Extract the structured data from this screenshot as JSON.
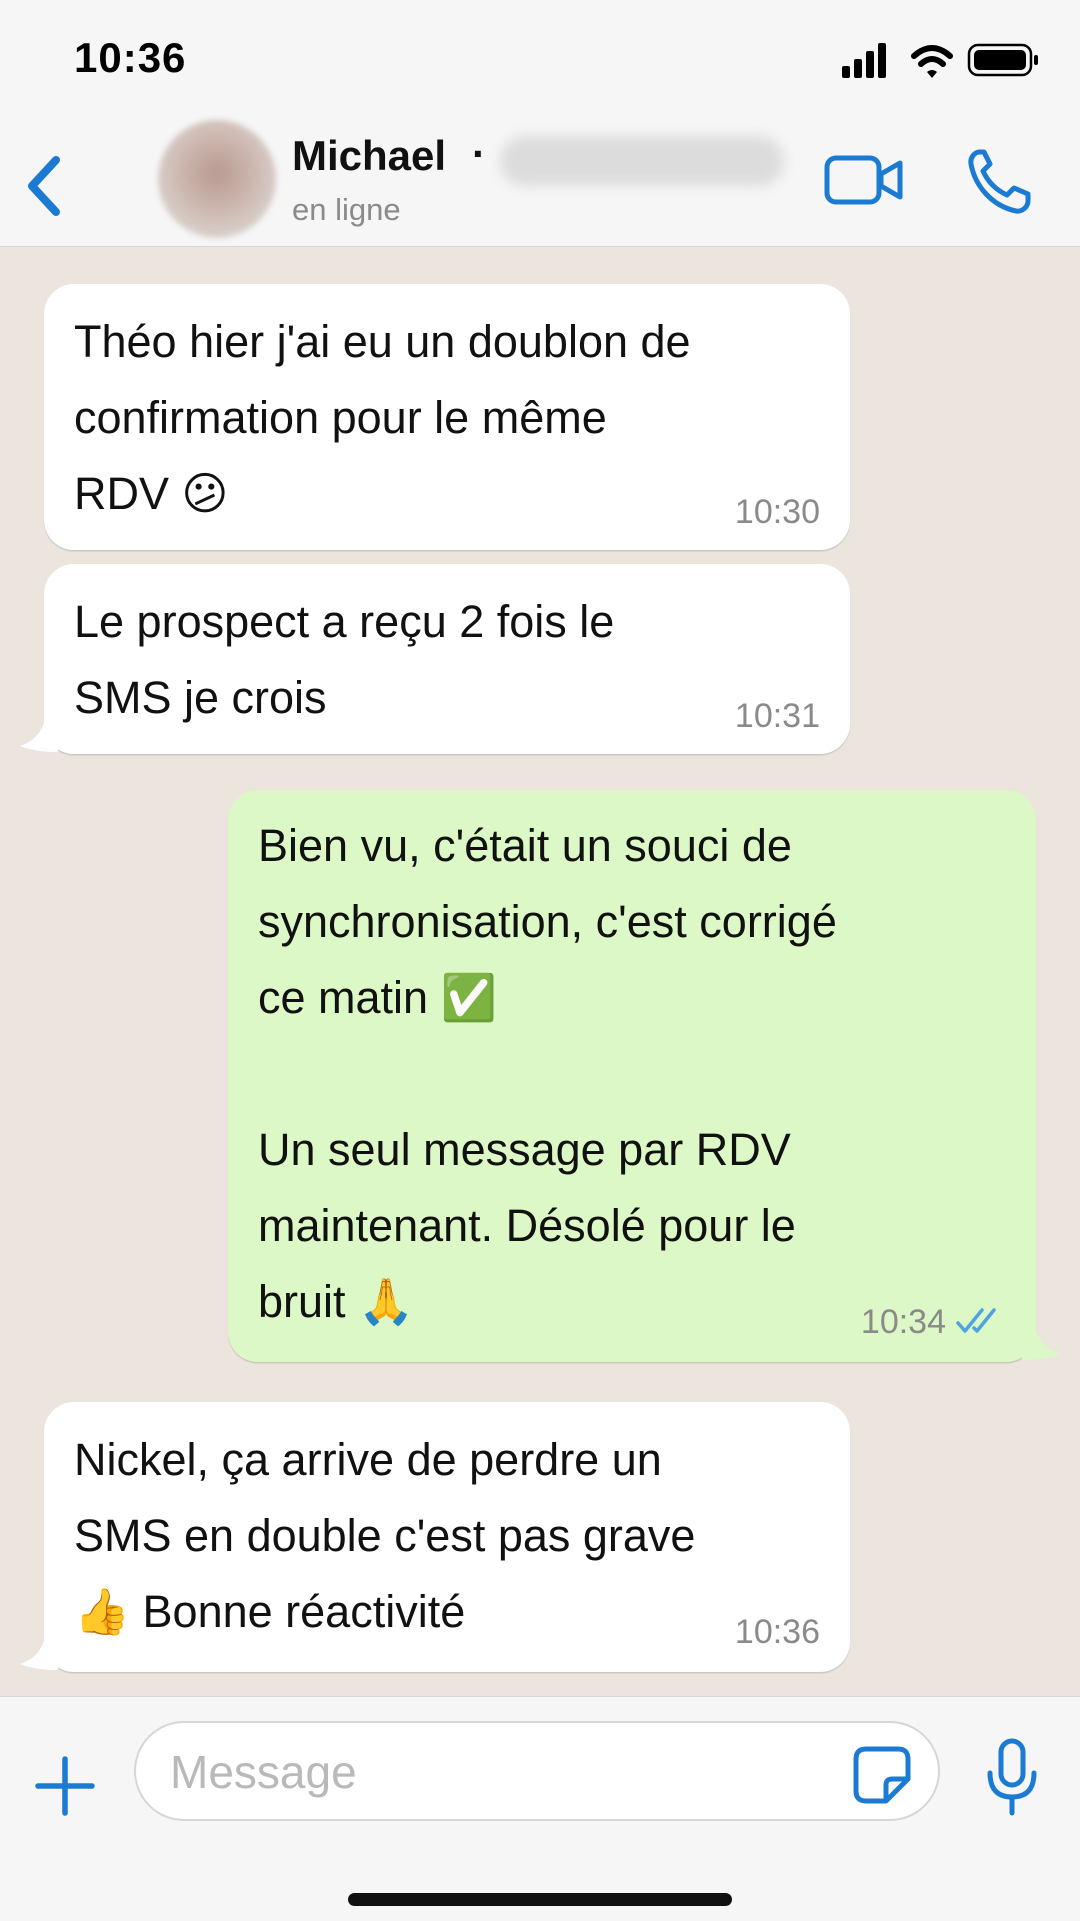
{
  "status_bar": {
    "time": "10:36"
  },
  "header": {
    "contact_name": "Michael",
    "separator": "·",
    "contact_status": "en ligne",
    "accent_color": "#1B7BD2"
  },
  "messages": [
    {
      "direction": "incoming",
      "text": "Théo hier j'ai eu un doublon de\nconfirmation pour le même\nRDV 😕",
      "time": "10:30"
    },
    {
      "direction": "incoming",
      "text": "Le prospect a reçu 2 fois le\nSMS je crois",
      "time": "10:31"
    },
    {
      "direction": "outgoing",
      "text": "Bien vu, c'était un souci de\nsynchronisation, c'est corrigé\nce matin ✅\n\nUn seul message par RDV\nmaintenant. Désolé pour le\nbruit 🙏",
      "time": "10:34",
      "status": "read"
    },
    {
      "direction": "incoming",
      "text": "Nickel, ça arrive de perdre un\nSMS en double c'est pas grave\n👍 Bonne réactivité",
      "time": "10:36"
    }
  ],
  "composer": {
    "placeholder": "Message"
  },
  "icons": [
    "back-chevron-icon",
    "video-call-icon",
    "phone-icon",
    "plus-icon",
    "sticker-icon",
    "microphone-icon",
    "double-check-icon"
  ]
}
